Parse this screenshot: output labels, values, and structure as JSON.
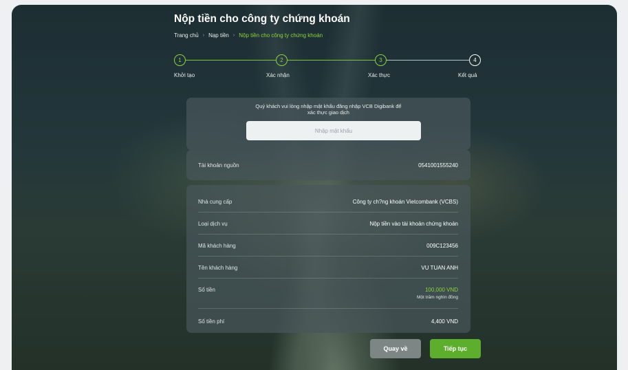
{
  "page": {
    "title": "Nộp tiền cho công ty chứng khoán",
    "breadcrumb": [
      "Trang chủ",
      "Nạp tiền",
      "Nộp tiền cho công ty chứng khoán"
    ]
  },
  "stepper": {
    "steps": [
      {
        "num": "1",
        "label": "Khởi tạo",
        "status": "done"
      },
      {
        "num": "2",
        "label": "Xác nhận",
        "status": "done"
      },
      {
        "num": "3",
        "label": "Xác thực",
        "status": "done"
      },
      {
        "num": "4",
        "label": "Kết quả",
        "status": "todo"
      }
    ]
  },
  "password": {
    "message_line1": "Quý khách vui lòng nhập mật khẩu đăng nhập VCB Digibank để",
    "message_line2": "xác thực giao dịch",
    "placeholder": "Nhập mật khẩu",
    "value": ""
  },
  "source_account": {
    "label": "Tài khoản nguồn",
    "value": "0541001555240"
  },
  "details": {
    "rows": [
      {
        "label": "Nhà cung cấp",
        "value": "Công ty ch?ng khoán Vietcombank (VCBS)"
      },
      {
        "label": "Loại dịch vụ",
        "value": "Nộp tiền vào tài khoản chứng khoán"
      },
      {
        "label": "Mã khách hàng",
        "value": "009C123456"
      },
      {
        "label": "Tên khách hàng",
        "value": "VU TUAN ANH"
      },
      {
        "label": "Số tiền",
        "value": "100,000 VND",
        "sub": "Một trăm nghìn đồng"
      },
      {
        "label": "Số tiền phí",
        "value": "4,400 VND"
      }
    ]
  },
  "buttons": {
    "back": "Quay về",
    "next": "Tiếp tục"
  },
  "colors": {
    "accent": "#8ed23f",
    "primary_button": "#5dae2c",
    "secondary_button": "#7d8684",
    "card": "#48565a"
  }
}
